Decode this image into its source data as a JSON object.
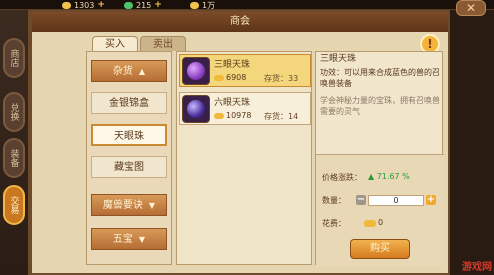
{
  "resources": [
    {
      "value": "1303",
      "color": "#f2c24a"
    },
    {
      "value": "215",
      "color": "#4cc46a"
    },
    {
      "value": "1万",
      "color": "#f2c24a"
    }
  ],
  "side_tabs": [
    {
      "label": "商店",
      "active": false
    },
    {
      "label": "兑换",
      "active": false
    },
    {
      "label": "装备",
      "active": false
    },
    {
      "label": "交易",
      "active": true
    }
  ],
  "panel": {
    "title": "商会"
  },
  "tabs": {
    "buy": "买入",
    "sell": "卖出"
  },
  "categories": {
    "main": [
      {
        "label": "杂货"
      },
      {
        "label": "魔兽要诀"
      },
      {
        "label": "五宝"
      }
    ],
    "sub": [
      {
        "label": "金银锦盒"
      },
      {
        "label": "天眼珠",
        "active": true
      },
      {
        "label": "藏宝图"
      }
    ]
  },
  "items": [
    {
      "name": "三眼天珠",
      "price": "6908",
      "stock": "存货：33",
      "gem_color": "#8a3fc0",
      "active": true
    },
    {
      "name": "六眼天珠",
      "price": "10978",
      "stock": "存货：14",
      "gem_color": "#4a2f9a",
      "active": false
    }
  ],
  "detail": {
    "name": "三眼天珠",
    "effect": "功效：可以用来合成蓝色的兽的召唤兽装备",
    "note": "学会神秘力量的宝珠，拥有召唤兽需要的灵气",
    "price_change_label": "价格涨跌：",
    "price_change": "▲ 71.67 %",
    "qty_label": "数量：",
    "qty": "0",
    "cost_label": "花费：",
    "cost": "0",
    "buy_button": "购买"
  },
  "help": "!",
  "close": "✕",
  "watermark": "游戏网"
}
